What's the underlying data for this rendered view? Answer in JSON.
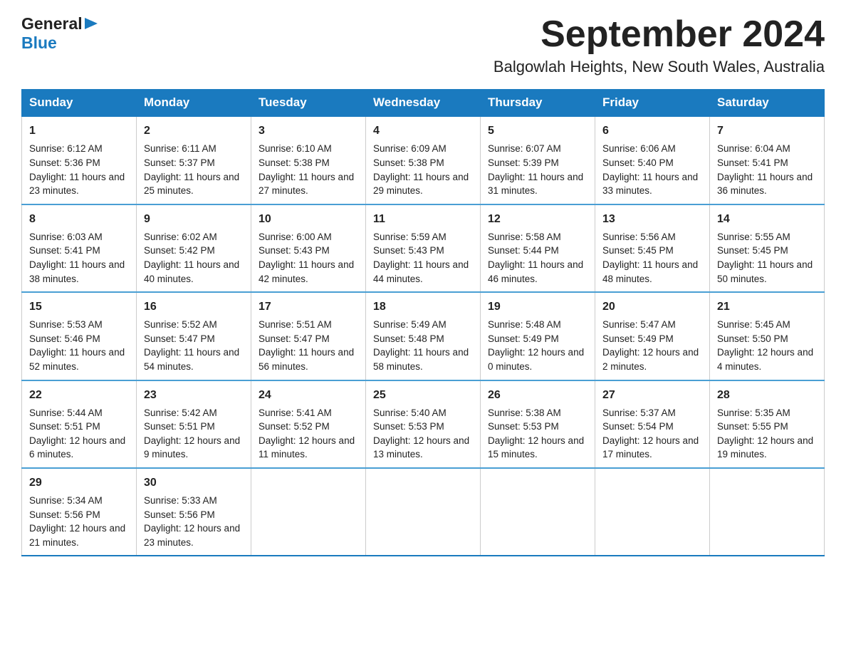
{
  "header": {
    "month_title": "September 2024",
    "location": "Balgowlah Heights, New South Wales, Australia",
    "logo_general": "General",
    "logo_blue": "Blue"
  },
  "days_of_week": [
    "Sunday",
    "Monday",
    "Tuesday",
    "Wednesday",
    "Thursday",
    "Friday",
    "Saturday"
  ],
  "weeks": [
    [
      {
        "day": "1",
        "sunrise": "Sunrise: 6:12 AM",
        "sunset": "Sunset: 5:36 PM",
        "daylight": "Daylight: 11 hours and 23 minutes."
      },
      {
        "day": "2",
        "sunrise": "Sunrise: 6:11 AM",
        "sunset": "Sunset: 5:37 PM",
        "daylight": "Daylight: 11 hours and 25 minutes."
      },
      {
        "day": "3",
        "sunrise": "Sunrise: 6:10 AM",
        "sunset": "Sunset: 5:38 PM",
        "daylight": "Daylight: 11 hours and 27 minutes."
      },
      {
        "day": "4",
        "sunrise": "Sunrise: 6:09 AM",
        "sunset": "Sunset: 5:38 PM",
        "daylight": "Daylight: 11 hours and 29 minutes."
      },
      {
        "day": "5",
        "sunrise": "Sunrise: 6:07 AM",
        "sunset": "Sunset: 5:39 PM",
        "daylight": "Daylight: 11 hours and 31 minutes."
      },
      {
        "day": "6",
        "sunrise": "Sunrise: 6:06 AM",
        "sunset": "Sunset: 5:40 PM",
        "daylight": "Daylight: 11 hours and 33 minutes."
      },
      {
        "day": "7",
        "sunrise": "Sunrise: 6:04 AM",
        "sunset": "Sunset: 5:41 PM",
        "daylight": "Daylight: 11 hours and 36 minutes."
      }
    ],
    [
      {
        "day": "8",
        "sunrise": "Sunrise: 6:03 AM",
        "sunset": "Sunset: 5:41 PM",
        "daylight": "Daylight: 11 hours and 38 minutes."
      },
      {
        "day": "9",
        "sunrise": "Sunrise: 6:02 AM",
        "sunset": "Sunset: 5:42 PM",
        "daylight": "Daylight: 11 hours and 40 minutes."
      },
      {
        "day": "10",
        "sunrise": "Sunrise: 6:00 AM",
        "sunset": "Sunset: 5:43 PM",
        "daylight": "Daylight: 11 hours and 42 minutes."
      },
      {
        "day": "11",
        "sunrise": "Sunrise: 5:59 AM",
        "sunset": "Sunset: 5:43 PM",
        "daylight": "Daylight: 11 hours and 44 minutes."
      },
      {
        "day": "12",
        "sunrise": "Sunrise: 5:58 AM",
        "sunset": "Sunset: 5:44 PM",
        "daylight": "Daylight: 11 hours and 46 minutes."
      },
      {
        "day": "13",
        "sunrise": "Sunrise: 5:56 AM",
        "sunset": "Sunset: 5:45 PM",
        "daylight": "Daylight: 11 hours and 48 minutes."
      },
      {
        "day": "14",
        "sunrise": "Sunrise: 5:55 AM",
        "sunset": "Sunset: 5:45 PM",
        "daylight": "Daylight: 11 hours and 50 minutes."
      }
    ],
    [
      {
        "day": "15",
        "sunrise": "Sunrise: 5:53 AM",
        "sunset": "Sunset: 5:46 PM",
        "daylight": "Daylight: 11 hours and 52 minutes."
      },
      {
        "day": "16",
        "sunrise": "Sunrise: 5:52 AM",
        "sunset": "Sunset: 5:47 PM",
        "daylight": "Daylight: 11 hours and 54 minutes."
      },
      {
        "day": "17",
        "sunrise": "Sunrise: 5:51 AM",
        "sunset": "Sunset: 5:47 PM",
        "daylight": "Daylight: 11 hours and 56 minutes."
      },
      {
        "day": "18",
        "sunrise": "Sunrise: 5:49 AM",
        "sunset": "Sunset: 5:48 PM",
        "daylight": "Daylight: 11 hours and 58 minutes."
      },
      {
        "day": "19",
        "sunrise": "Sunrise: 5:48 AM",
        "sunset": "Sunset: 5:49 PM",
        "daylight": "Daylight: 12 hours and 0 minutes."
      },
      {
        "day": "20",
        "sunrise": "Sunrise: 5:47 AM",
        "sunset": "Sunset: 5:49 PM",
        "daylight": "Daylight: 12 hours and 2 minutes."
      },
      {
        "day": "21",
        "sunrise": "Sunrise: 5:45 AM",
        "sunset": "Sunset: 5:50 PM",
        "daylight": "Daylight: 12 hours and 4 minutes."
      }
    ],
    [
      {
        "day": "22",
        "sunrise": "Sunrise: 5:44 AM",
        "sunset": "Sunset: 5:51 PM",
        "daylight": "Daylight: 12 hours and 6 minutes."
      },
      {
        "day": "23",
        "sunrise": "Sunrise: 5:42 AM",
        "sunset": "Sunset: 5:51 PM",
        "daylight": "Daylight: 12 hours and 9 minutes."
      },
      {
        "day": "24",
        "sunrise": "Sunrise: 5:41 AM",
        "sunset": "Sunset: 5:52 PM",
        "daylight": "Daylight: 12 hours and 11 minutes."
      },
      {
        "day": "25",
        "sunrise": "Sunrise: 5:40 AM",
        "sunset": "Sunset: 5:53 PM",
        "daylight": "Daylight: 12 hours and 13 minutes."
      },
      {
        "day": "26",
        "sunrise": "Sunrise: 5:38 AM",
        "sunset": "Sunset: 5:53 PM",
        "daylight": "Daylight: 12 hours and 15 minutes."
      },
      {
        "day": "27",
        "sunrise": "Sunrise: 5:37 AM",
        "sunset": "Sunset: 5:54 PM",
        "daylight": "Daylight: 12 hours and 17 minutes."
      },
      {
        "day": "28",
        "sunrise": "Sunrise: 5:35 AM",
        "sunset": "Sunset: 5:55 PM",
        "daylight": "Daylight: 12 hours and 19 minutes."
      }
    ],
    [
      {
        "day": "29",
        "sunrise": "Sunrise: 5:34 AM",
        "sunset": "Sunset: 5:56 PM",
        "daylight": "Daylight: 12 hours and 21 minutes."
      },
      {
        "day": "30",
        "sunrise": "Sunrise: 5:33 AM",
        "sunset": "Sunset: 5:56 PM",
        "daylight": "Daylight: 12 hours and 23 minutes."
      },
      {
        "day": "",
        "sunrise": "",
        "sunset": "",
        "daylight": ""
      },
      {
        "day": "",
        "sunrise": "",
        "sunset": "",
        "daylight": ""
      },
      {
        "day": "",
        "sunrise": "",
        "sunset": "",
        "daylight": ""
      },
      {
        "day": "",
        "sunrise": "",
        "sunset": "",
        "daylight": ""
      },
      {
        "day": "",
        "sunrise": "",
        "sunset": "",
        "daylight": ""
      }
    ]
  ]
}
